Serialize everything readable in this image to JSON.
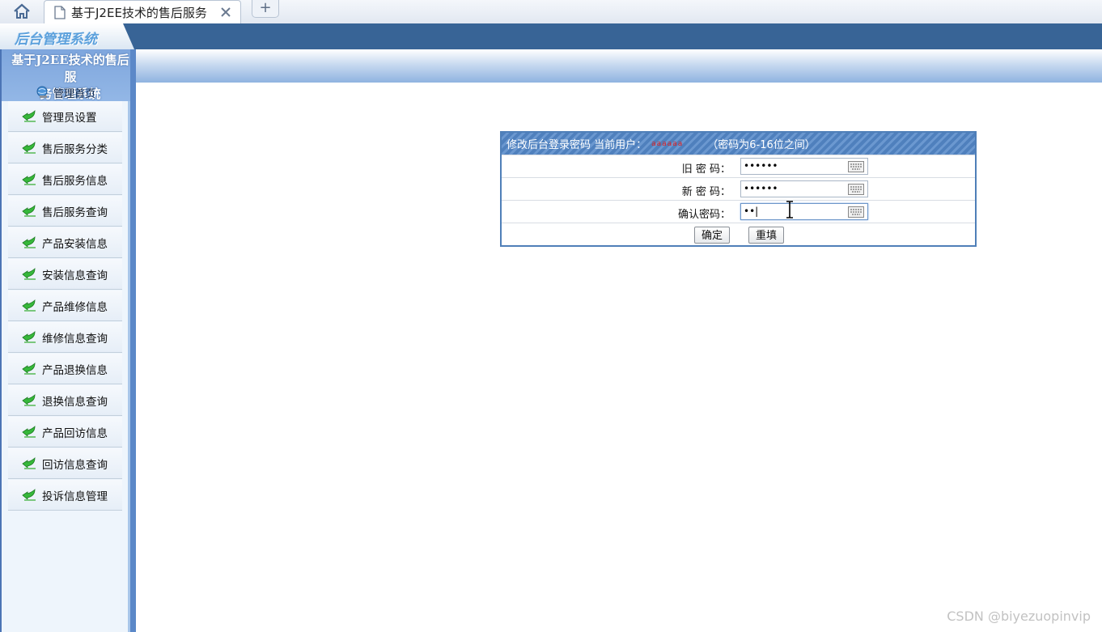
{
  "browser": {
    "tab_title": "基于J2EE技术的售后服务",
    "new_tab_label": "+"
  },
  "app": {
    "logo_text": "后台管理系统",
    "system_title_line1": "基于J2EE技术的售后服",
    "system_title_line2": "务管理系统",
    "home_label": "管理首页"
  },
  "sidebar": {
    "items": [
      {
        "label": "管理员设置"
      },
      {
        "label": "售后服务分类"
      },
      {
        "label": "售后服务信息"
      },
      {
        "label": "售后服务查询"
      },
      {
        "label": "产品安装信息"
      },
      {
        "label": "安装信息查询"
      },
      {
        "label": "产品维修信息"
      },
      {
        "label": "维修信息查询"
      },
      {
        "label": "产品退换信息"
      },
      {
        "label": "退换信息查询"
      },
      {
        "label": "产品回访信息"
      },
      {
        "label": "回访信息查询"
      },
      {
        "label": "投诉信息管理"
      }
    ]
  },
  "password_form": {
    "title": "修改后台登录密码 当前用户：",
    "current_user": "aaaaaa",
    "hint": "（密码为6-16位之间）",
    "old_password_label": "旧 密 码：",
    "old_password_value": "••••••",
    "new_password_label": "新 密 码：",
    "new_password_value": "••••••",
    "confirm_password_label": "确认密码：",
    "confirm_password_value": "••|",
    "submit_label": "确定",
    "reset_label": "重填"
  },
  "watermark": "CSDN @biyezuopinvip",
  "colors": {
    "header_blue": "#386496",
    "panel_border": "#4f7fb8",
    "current_user_red": "#e02020"
  }
}
